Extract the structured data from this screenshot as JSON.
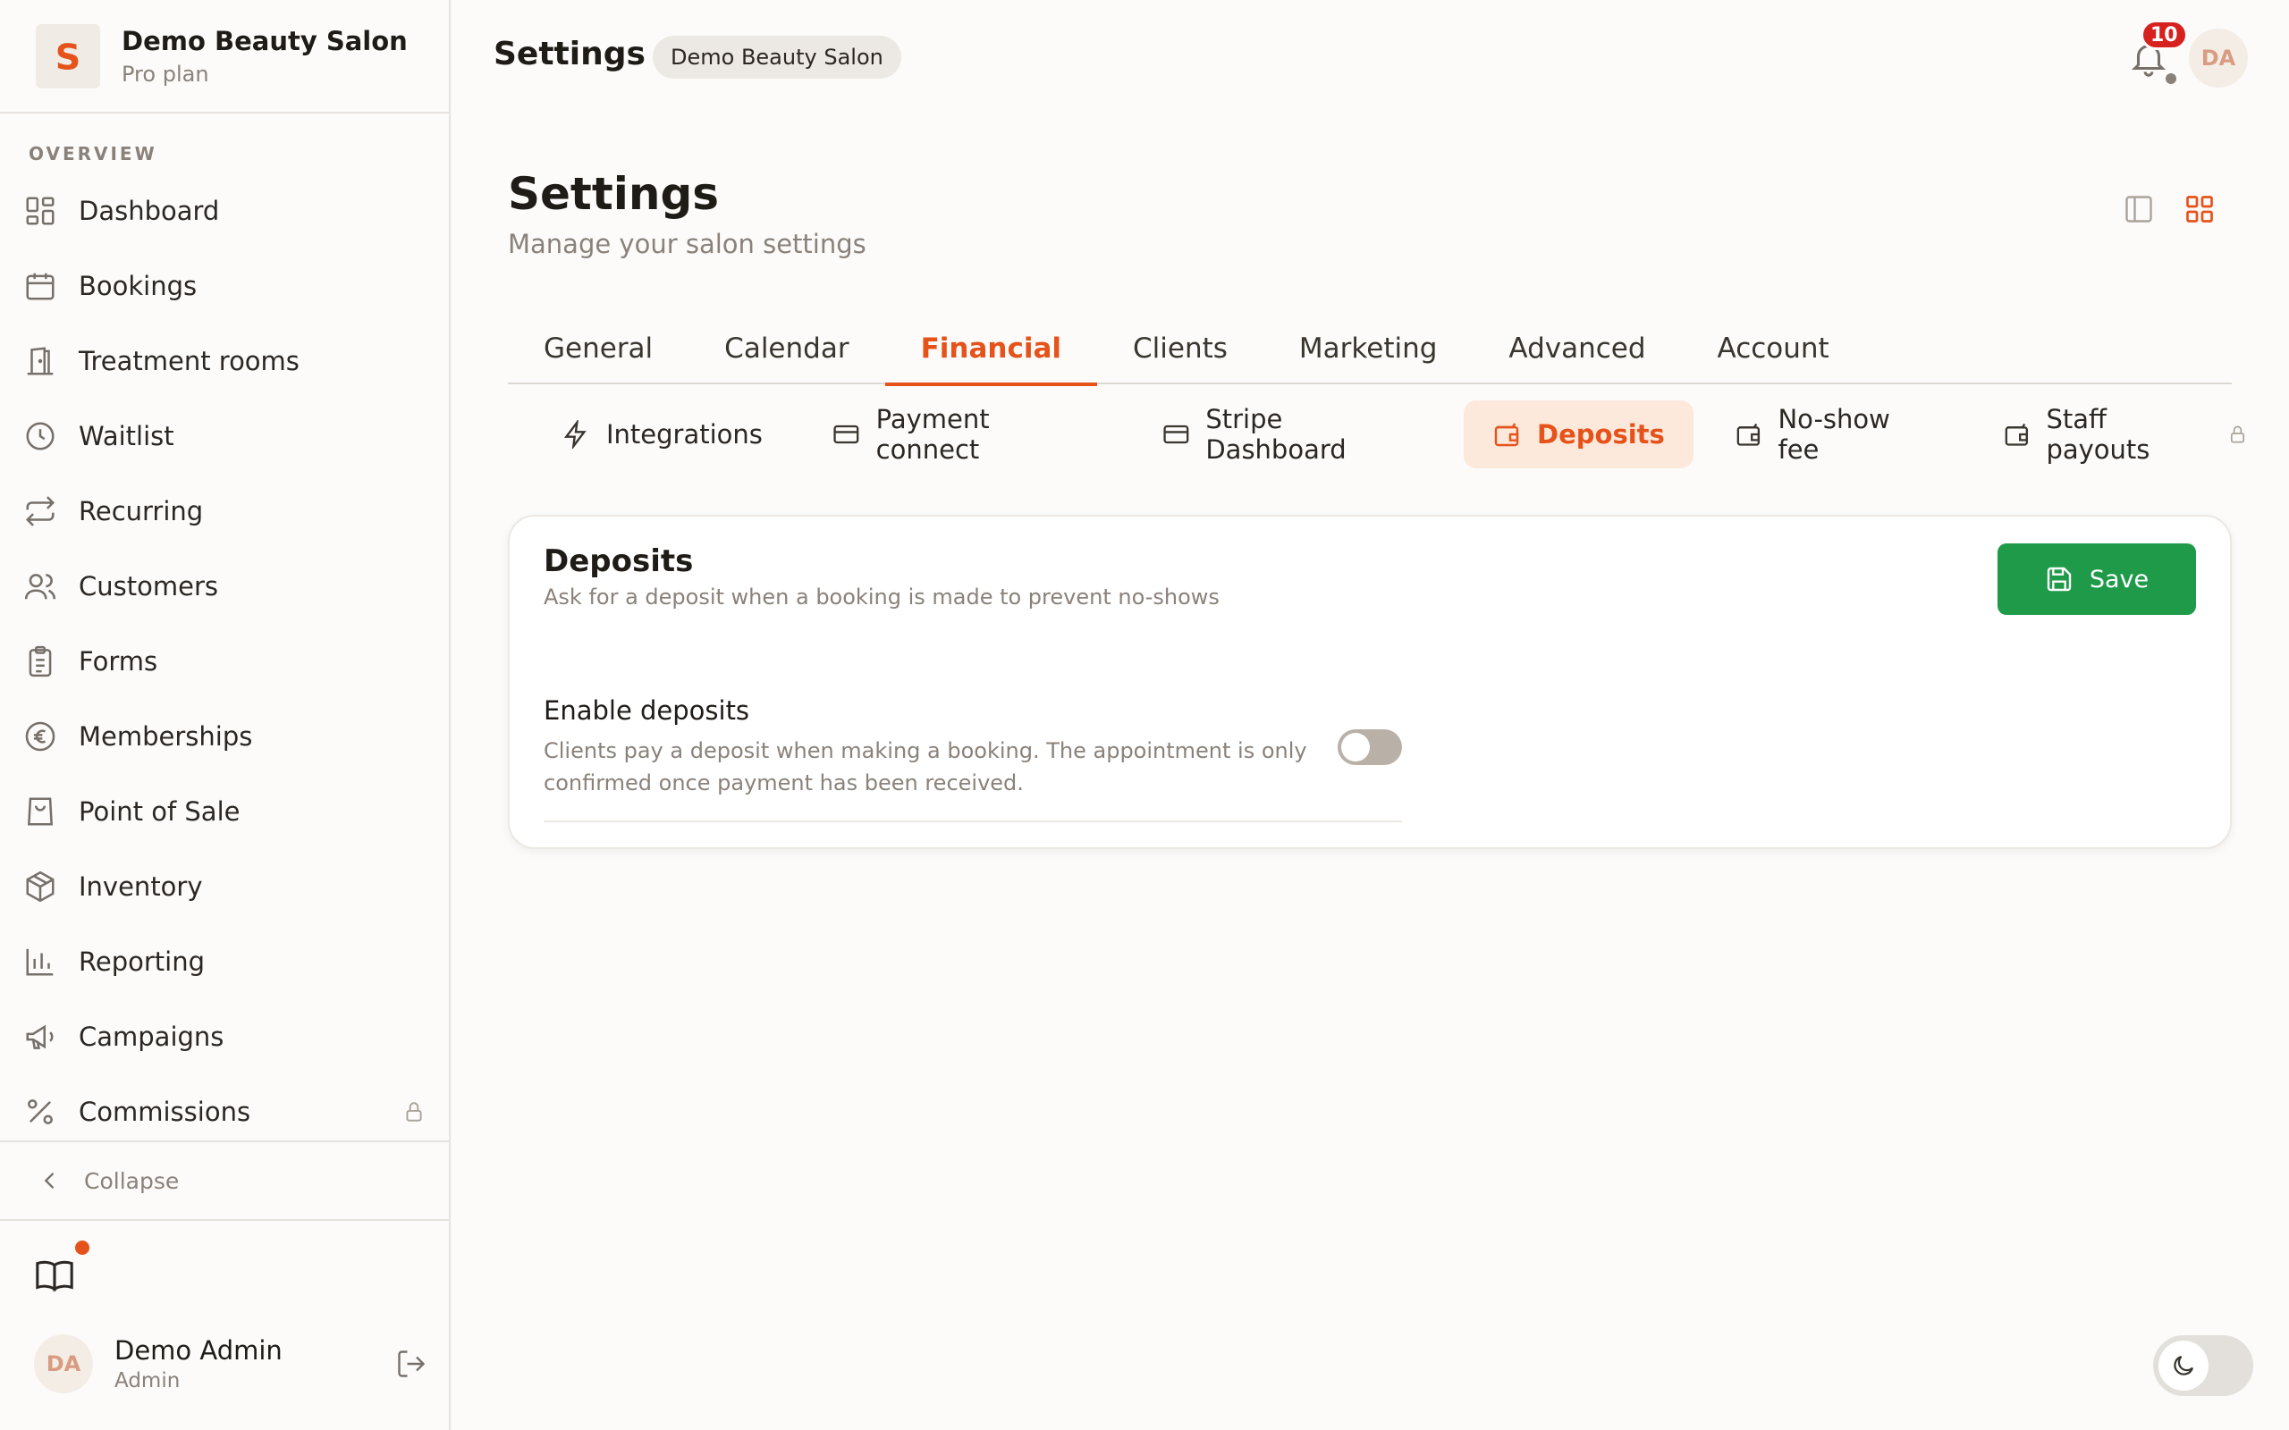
{
  "sidebar": {
    "brand": {
      "name": "Demo Beauty Salon",
      "plan": "Pro plan"
    },
    "section_label": "OVERVIEW",
    "items": [
      {
        "label": "Dashboard",
        "icon": "dashboard-icon"
      },
      {
        "label": "Bookings",
        "icon": "calendar-icon"
      },
      {
        "label": "Treatment rooms",
        "icon": "door-icon"
      },
      {
        "label": "Waitlist",
        "icon": "clock-icon"
      },
      {
        "label": "Recurring",
        "icon": "repeat-icon"
      },
      {
        "label": "Customers",
        "icon": "users-icon"
      },
      {
        "label": "Forms",
        "icon": "clipboard-icon"
      },
      {
        "label": "Memberships",
        "icon": "euro-icon"
      },
      {
        "label": "Point of Sale",
        "icon": "shopping-bag-icon"
      },
      {
        "label": "Inventory",
        "icon": "package-icon"
      },
      {
        "label": "Reporting",
        "icon": "bar-chart-icon"
      },
      {
        "label": "Campaigns",
        "icon": "megaphone-icon"
      },
      {
        "label": "Commissions",
        "icon": "percent-icon",
        "locked": true
      }
    ],
    "collapse_label": "Collapse",
    "user": {
      "initials": "DA",
      "name": "Demo Admin",
      "role": "Admin"
    }
  },
  "header": {
    "title": "Settings",
    "badge": "Demo Beauty Salon",
    "notifications_count": "10",
    "avatar_initials": "DA"
  },
  "main": {
    "title": "Settings",
    "subtitle": "Manage your salon settings",
    "tabs": [
      {
        "label": "General"
      },
      {
        "label": "Calendar"
      },
      {
        "label": "Financial",
        "active": true
      },
      {
        "label": "Clients"
      },
      {
        "label": "Marketing"
      },
      {
        "label": "Advanced"
      },
      {
        "label": "Account"
      }
    ],
    "subtabs": [
      {
        "label": "Integrations",
        "icon": "zap-icon"
      },
      {
        "label": "Payment connect",
        "icon": "credit-card-icon"
      },
      {
        "label": "Stripe Dashboard",
        "icon": "credit-card-icon"
      },
      {
        "label": "Deposits",
        "icon": "wallet-icon",
        "active": true
      },
      {
        "label": "No-show fee",
        "icon": "wallet-icon"
      },
      {
        "label": "Staff payouts",
        "icon": "wallet-icon",
        "locked": true
      }
    ],
    "card": {
      "title": "Deposits",
      "description": "Ask for a deposit when a booking is made to prevent no-shows",
      "save_label": "Save",
      "setting": {
        "label": "Enable deposits",
        "help": "Clients pay a deposit when making a booking. The appointment is only confirmed once payment has been received.",
        "enabled": false
      }
    }
  },
  "colors": {
    "accent": "#e5531a",
    "save": "#1e9a49",
    "notification": "#d7211f"
  }
}
